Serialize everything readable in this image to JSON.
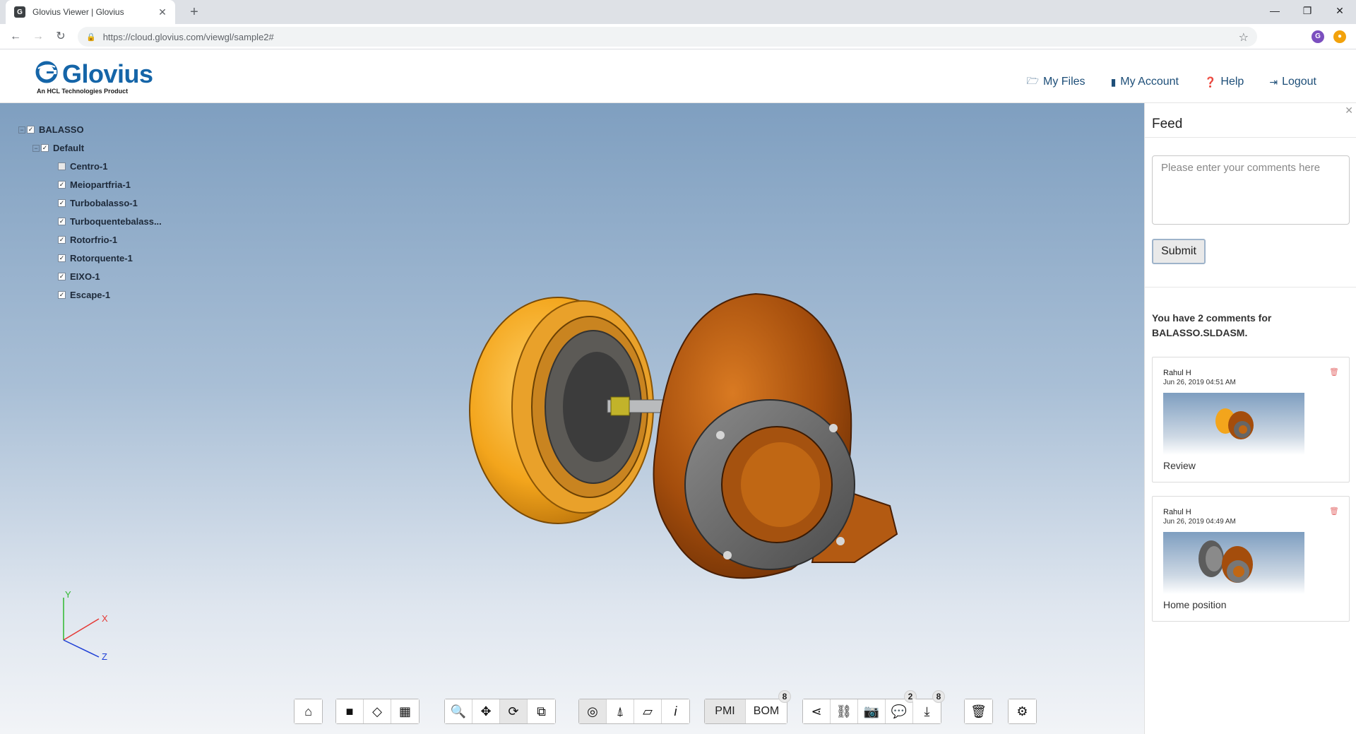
{
  "browser": {
    "tab_title": "Glovius Viewer | Glovius",
    "favicon_letter": "G",
    "url": "https://cloud.glovius.com/viewgl/sample2#",
    "profile_letter": "G"
  },
  "app": {
    "brand": "Glovius",
    "tagline": "An HCL Technologies Product",
    "brand_color": "#1565a8",
    "nav": [
      {
        "icon": "files-icon",
        "label": "My Files"
      },
      {
        "icon": "account-icon",
        "label": "My Account"
      },
      {
        "icon": "help-icon",
        "label": "Help"
      },
      {
        "icon": "logout-icon",
        "label": "Logout"
      }
    ]
  },
  "tree": {
    "root": "BALASSO",
    "config": "Default",
    "parts": [
      {
        "name": "Centro-1",
        "checked": false
      },
      {
        "name": "Meiopartfria-1",
        "checked": true
      },
      {
        "name": "Turbobalasso-1",
        "checked": true
      },
      {
        "name": "Turboquentebalass...",
        "checked": true
      },
      {
        "name": "Rotorfrio-1",
        "checked": true
      },
      {
        "name": "Rotorquente-1",
        "checked": true
      },
      {
        "name": "EIXO-1",
        "checked": true
      },
      {
        "name": "Escape-1",
        "checked": true
      }
    ]
  },
  "axes": {
    "x": "X",
    "y": "Y",
    "z": "Z"
  },
  "toolbar": {
    "pmi_label": "PMI",
    "bom_label": "BOM",
    "bom_count": "8",
    "comments_count": "2",
    "downloads_count": "8"
  },
  "feed": {
    "title": "Feed",
    "placeholder": "Please enter your comments here",
    "submit_label": "Submit",
    "count_text": "You have 2 comments for BALASSO.SLDASM.",
    "comments": [
      {
        "author": "Rahul H",
        "date": "Jun 26, 2019 04:51 AM",
        "caption": "Review"
      },
      {
        "author": "Rahul H",
        "date": "Jun 26, 2019 04:49 AM",
        "caption": "Home position"
      }
    ]
  }
}
